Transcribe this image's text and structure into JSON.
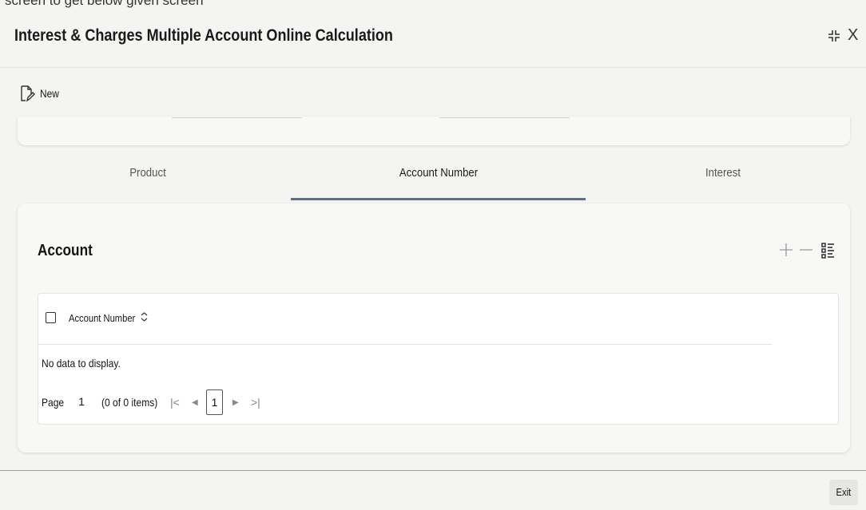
{
  "caption": "screen to get below given screen",
  "window": {
    "title": "Interest & Charges Multiple Account Online Calculation",
    "collapse_icon": "collapse-icon",
    "close_label": "X"
  },
  "toolbar": {
    "new_label": "New",
    "new_icon": "new-document-icon"
  },
  "tabs": [
    {
      "label": "Product",
      "active": false
    },
    {
      "label": "Account Number",
      "active": true
    },
    {
      "label": "Interest",
      "active": false
    }
  ],
  "account_section": {
    "title": "Account",
    "actions": [
      "add-icon",
      "remove-icon",
      "columns-icon"
    ],
    "table": {
      "columns": [
        "Account Number"
      ],
      "rows": [],
      "empty_message": "No data to display."
    },
    "pagination": {
      "page_label": "Page",
      "page_value": "1",
      "count_text": "(0 of 0 items)",
      "first": "|<",
      "prev": "◀",
      "current": "1",
      "next": "▶",
      "last": ">|"
    }
  },
  "footer": {
    "exit_label": "Exit"
  },
  "colors": {
    "accent_underline": "#5b6f8a",
    "panel_bg": "#f8f8f7"
  }
}
